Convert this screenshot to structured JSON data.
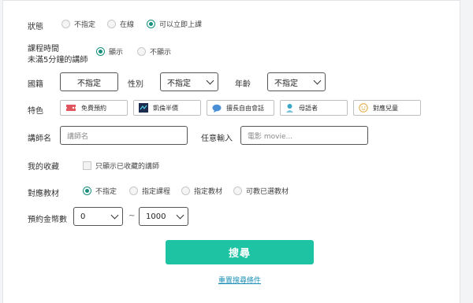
{
  "status": {
    "label": "狀態",
    "options": [
      "不指定",
      "在線",
      "可以立即上課"
    ]
  },
  "course_time": {
    "label_line1": "課程時間",
    "label_line2": "未滿5分鐘的講師",
    "options": [
      "顯示",
      "不顯示"
    ]
  },
  "nationality": {
    "label": "國籍",
    "value": "不指定"
  },
  "gender": {
    "label": "性別",
    "value": "不指定"
  },
  "age": {
    "label": "年齡",
    "value": "不指定"
  },
  "features": {
    "label": "特色",
    "tags": [
      "免費預約",
      "凱倫半價",
      "擅長自由會話",
      "母語者",
      "對應兒童"
    ]
  },
  "teacher_name": {
    "label": "講師名",
    "placeholder": "講師名"
  },
  "free_input": {
    "label": "任意輸入",
    "placeholder": "電影 movie..."
  },
  "favorites": {
    "label": "我的收藏",
    "checkbox_label": "只顯示已收藏的講師"
  },
  "materials": {
    "label": "對應教材",
    "options": [
      "不指定",
      "指定課程",
      "指定教材",
      "可教已選教材"
    ]
  },
  "price": {
    "label": "預約金幣數",
    "min": "0",
    "separator": "~",
    "max": "1000"
  },
  "search_button": "搜尋",
  "reset_link": "重置搜尋條件",
  "colors": {
    "accent": "#1ec3a3",
    "radio_checked": "#1a8f7f",
    "link": "#1a8fb5"
  }
}
